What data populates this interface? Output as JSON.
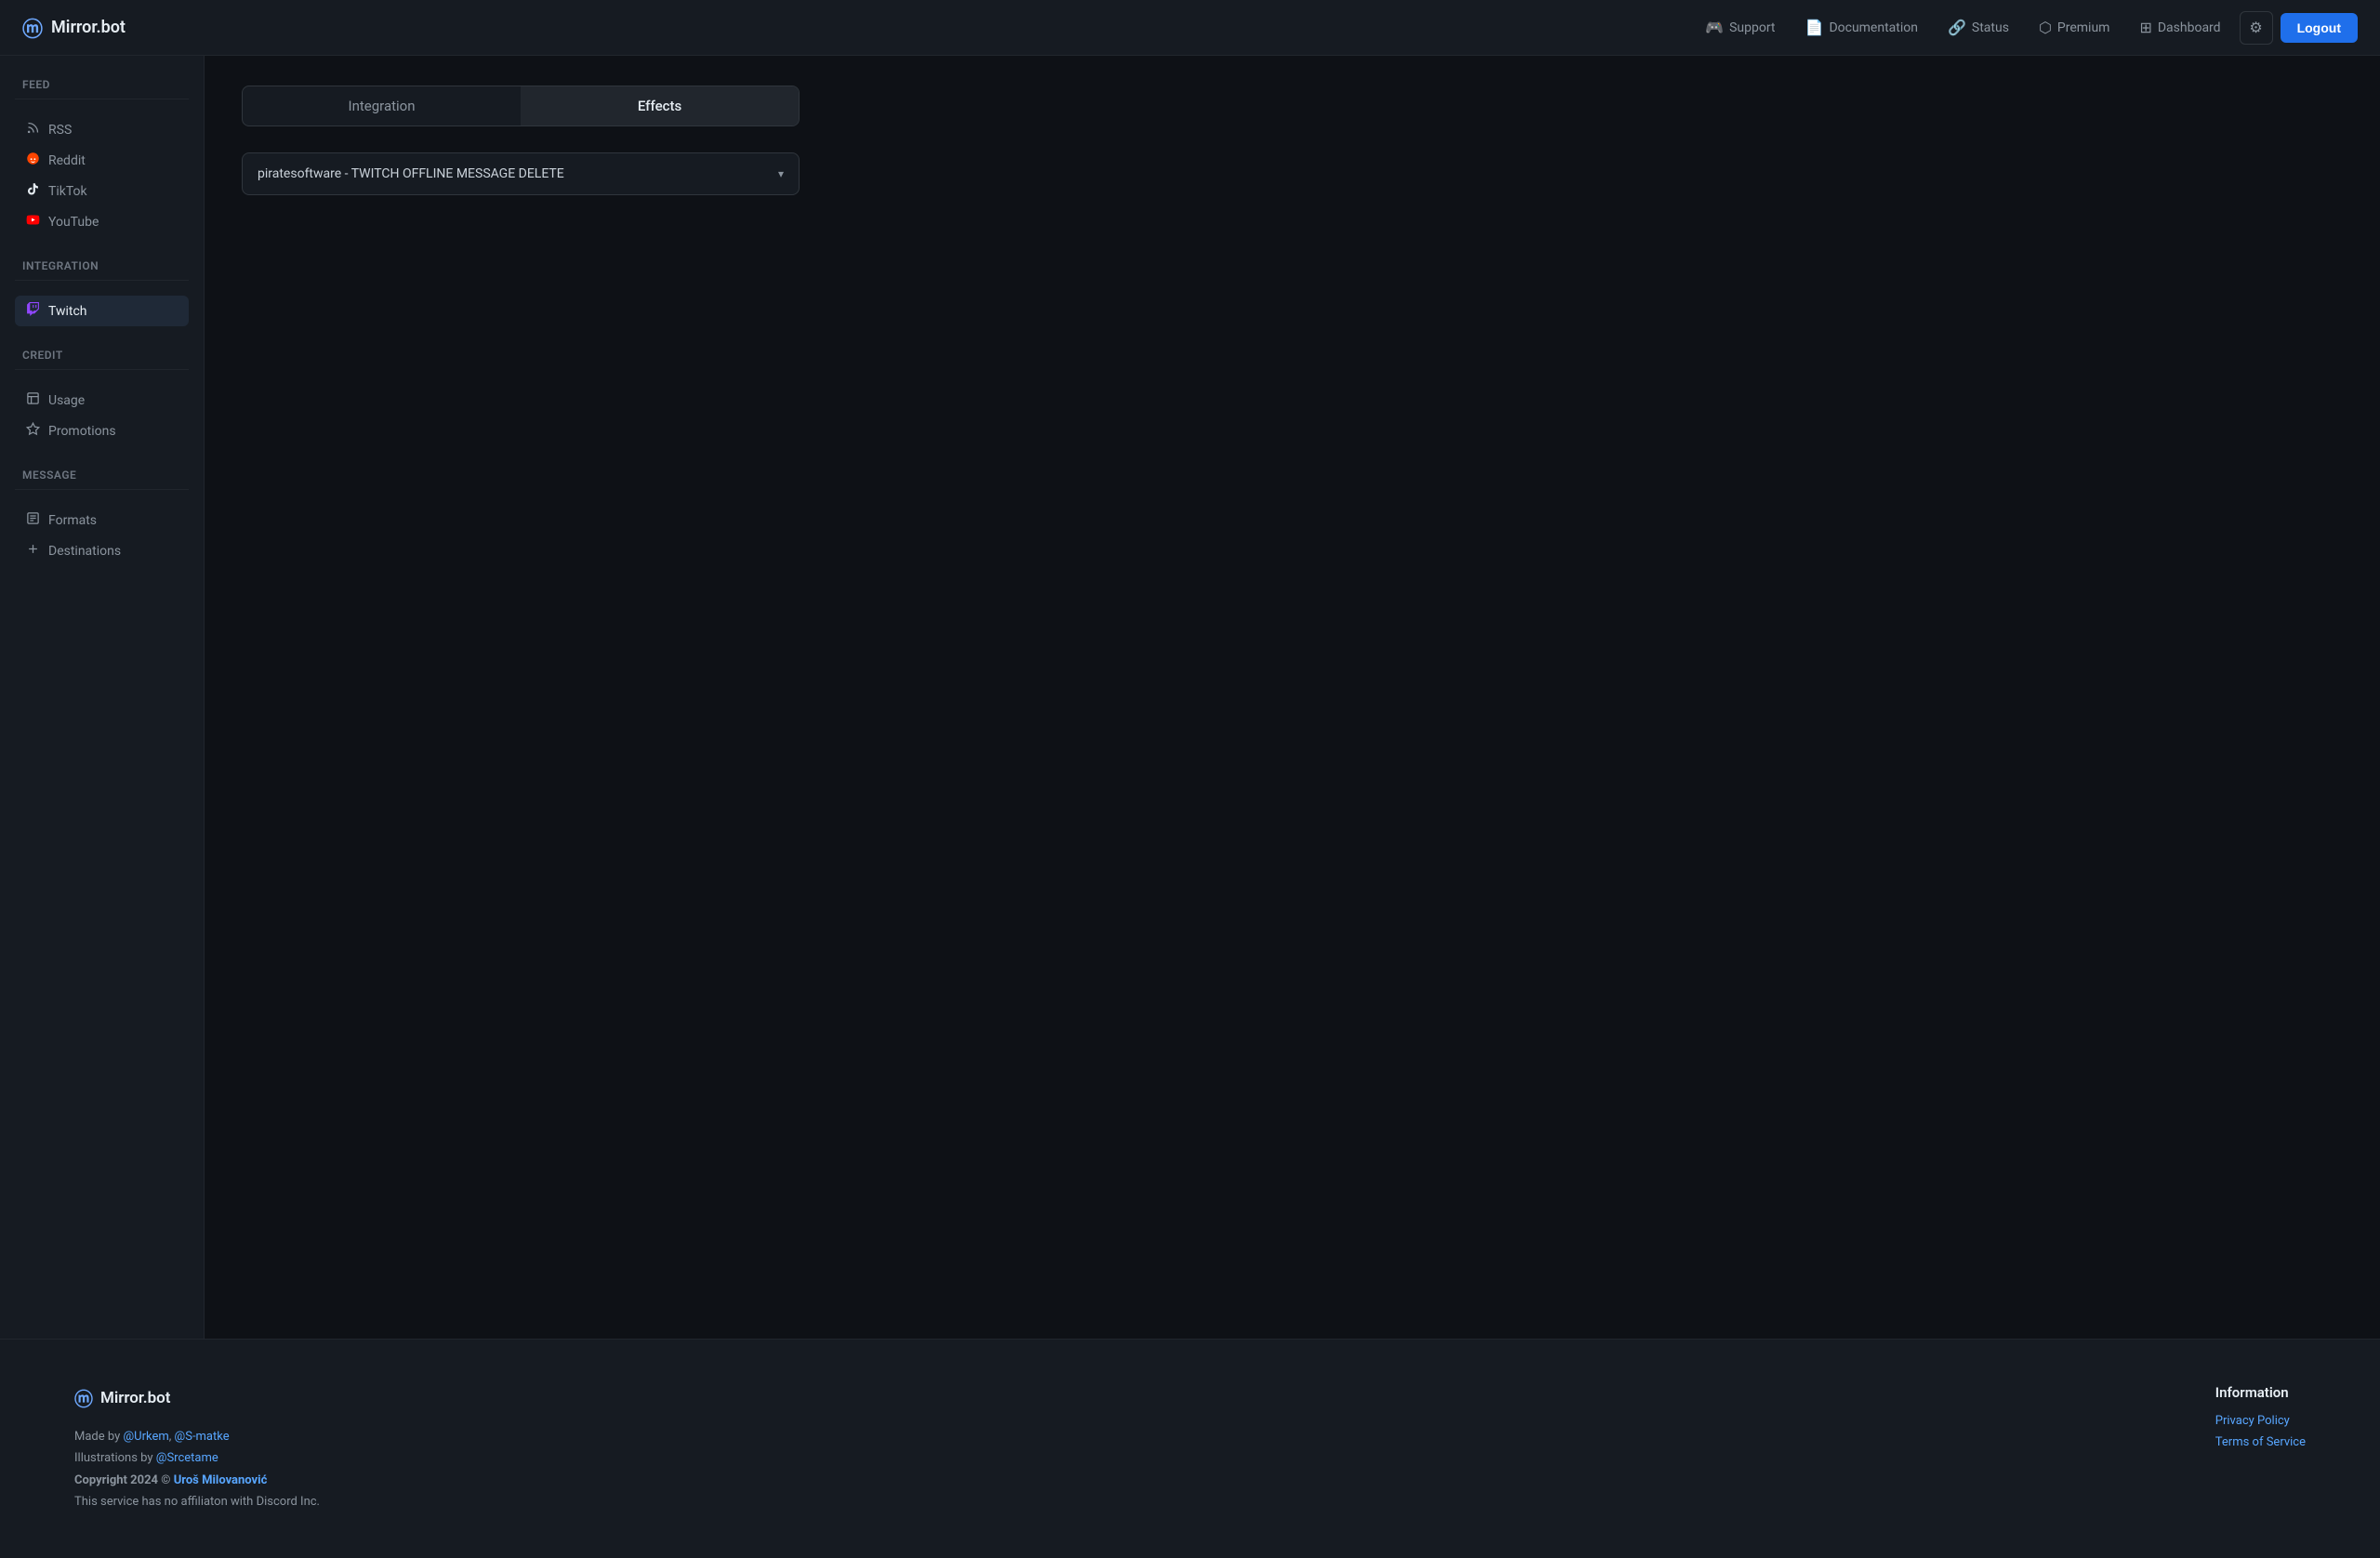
{
  "app": {
    "logo_icon": "m",
    "logo_text": "Mirror.bot"
  },
  "header": {
    "support_label": "Support",
    "documentation_label": "Documentation",
    "status_label": "Status",
    "premium_label": "Premium",
    "dashboard_label": "Dashboard",
    "logout_label": "Logout"
  },
  "sidebar": {
    "feed_section": "Feed",
    "integration_section": "Integration",
    "credit_section": "Credit",
    "message_section": "Message",
    "feed_items": [
      {
        "label": "RSS",
        "icon": "◈"
      },
      {
        "label": "Reddit",
        "icon": "●"
      },
      {
        "label": "TikTok",
        "icon": "♪"
      },
      {
        "label": "YouTube",
        "icon": "▶"
      }
    ],
    "integration_items": [
      {
        "label": "Twitch",
        "icon": "◉",
        "active": true
      }
    ],
    "credit_items": [
      {
        "label": "Usage",
        "icon": "☰"
      },
      {
        "label": "Promotions",
        "icon": "♛"
      }
    ],
    "message_items": [
      {
        "label": "Formats",
        "icon": "▤"
      },
      {
        "label": "Destinations",
        "icon": "✛"
      }
    ]
  },
  "main": {
    "tabs": [
      {
        "label": "Integration",
        "active": false
      },
      {
        "label": "Effects",
        "active": true
      }
    ],
    "dropdown": {
      "value": "piratesoftware - TWITCH OFFLINE MESSAGE DELETE",
      "arrow": "▾"
    }
  },
  "footer": {
    "logo_icon": "m",
    "logo_text": "Mirror.bot",
    "made_by_prefix": "Made by ",
    "author1": "@Urkem",
    "author1_url": "#",
    "author_separator": ", ",
    "author2": "@S-matke",
    "author2_url": "#",
    "illustrations_prefix": "Illustrations by ",
    "illustrator": "@Srcetame",
    "illustrator_url": "#",
    "copyright": "Copyright 2024 © ",
    "copyright_author": "Uroš Milovanović",
    "copyright_url": "#",
    "disclaimer": "This service has no affiliaton with Discord Inc.",
    "info_title": "Information",
    "privacy_label": "Privacy Policy",
    "privacy_url": "#",
    "tos_label": "Terms of Service",
    "tos_url": "#"
  }
}
